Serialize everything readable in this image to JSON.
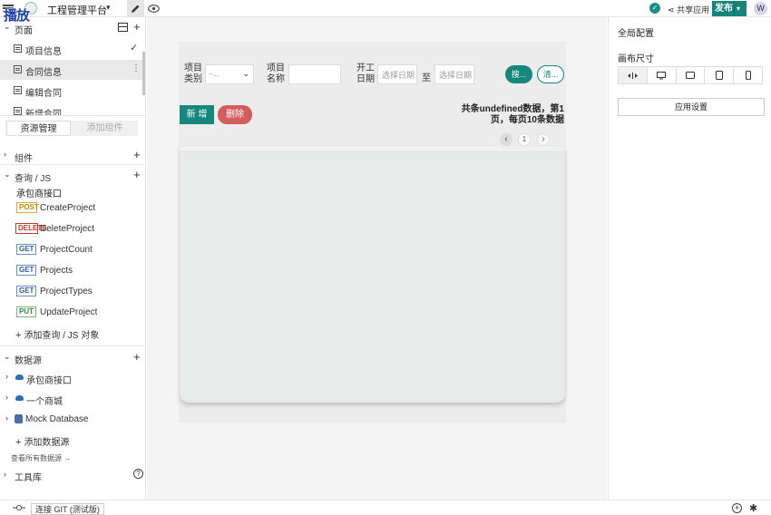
{
  "topbar": {
    "play_label": "播放",
    "app_name": "工程管理平台",
    "share_label": "共享应用",
    "publish_label": "发布",
    "avatar_initial": "W",
    "accent_color": "#14857a"
  },
  "left_panel": {
    "pages_label": "页面",
    "pages": [
      {
        "label": "项目信息",
        "selected": true
      },
      {
        "label": "合同信息",
        "hovered": true
      },
      {
        "label": "编辑合同"
      },
      {
        "label": "新增合同"
      }
    ],
    "tabs": {
      "resources": "资源管理",
      "add_widget": "添加组件"
    },
    "widgets_label": "组件",
    "queries_label": "查询 / JS",
    "query_group": "承包商接口",
    "apis": [
      {
        "method": "POST",
        "name": "CreateProject"
      },
      {
        "method": "DELETE",
        "name": "DeleteProject"
      },
      {
        "method": "GET",
        "name": "ProjectCount"
      },
      {
        "method": "GET",
        "name": "Projects"
      },
      {
        "method": "GET",
        "name": "ProjectTypes"
      },
      {
        "method": "PUT",
        "name": "UpdateProject"
      }
    ],
    "add_query_label": "添加查询 / JS 对象",
    "datasources_label": "数据源",
    "datasources": [
      {
        "name": "承包商接口",
        "icon": "cloud-icon"
      },
      {
        "name": "一个商城",
        "icon": "cloud-icon"
      },
      {
        "name": "Mock Database",
        "icon": "database-icon"
      }
    ],
    "add_datasource_label": "添加数据源",
    "see_all_label": "查看所有数据源",
    "toolbox_label": "工具库"
  },
  "canvas": {
    "filters": {
      "type_label": "项目类别",
      "type_placeholder": "-...",
      "name_label": "项目名称",
      "date_label": "开工日期",
      "date_start_placeholder": "选择日期",
      "to_label": "至",
      "date_end_placeholder": "选择日期"
    },
    "search_label": "搜...",
    "clear_label": "清...",
    "add_label": "新 增",
    "delete_label": "删除",
    "count_text": "共条undefined数据，第1页，每页10条数据",
    "page_number": "1"
  },
  "right_panel": {
    "title": "全局配置",
    "canvas_size_label": "画布尺寸",
    "size_options": [
      "fluid-width-icon",
      "desktop-icon",
      "tablet-landscape-icon",
      "tablet-icon",
      "mobile-icon"
    ],
    "app_settings_label": "应用设置"
  },
  "bottombar": {
    "git_label": "连接 GIT (测试版)"
  }
}
